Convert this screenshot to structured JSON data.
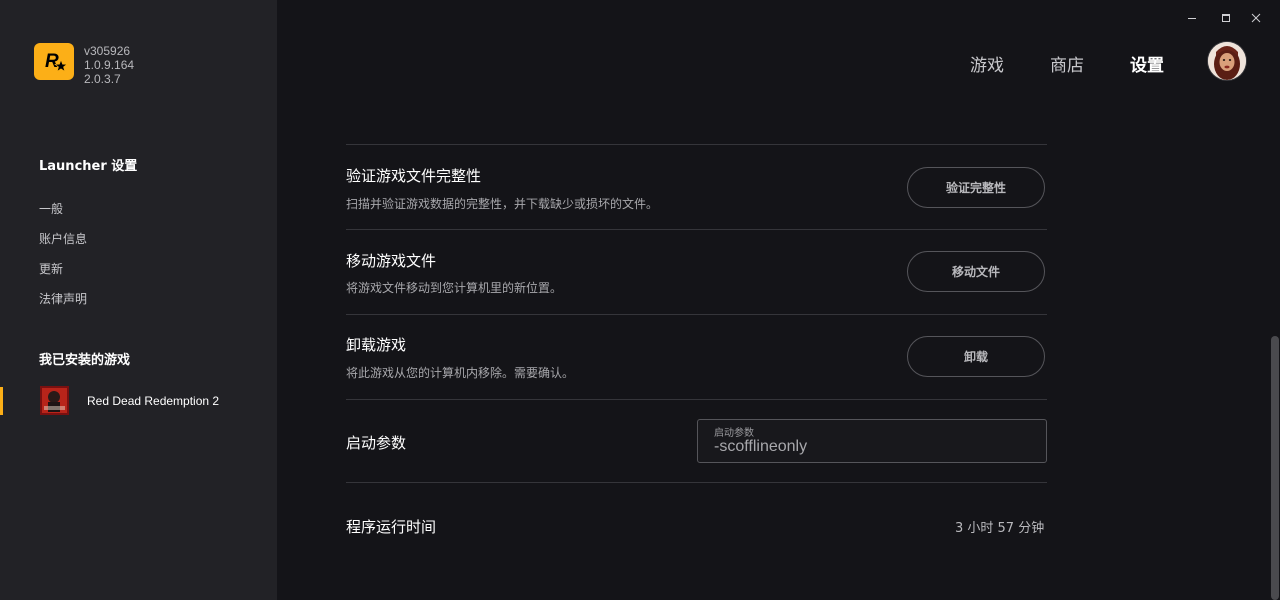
{
  "app": {
    "versions": [
      "v305926",
      "1.0.9.164",
      "2.0.3.7"
    ]
  },
  "sidebar": {
    "settings_title": "Launcher 设置",
    "items": [
      {
        "label": "一般"
      },
      {
        "label": "账户信息"
      },
      {
        "label": "更新"
      },
      {
        "label": "法律声明"
      }
    ],
    "installed_title": "我已安装的游戏",
    "games": [
      {
        "name": "Red Dead Redemption 2",
        "selected": true
      }
    ]
  },
  "topnav": {
    "tabs": [
      {
        "label": "游戏",
        "active": false
      },
      {
        "label": "商店",
        "active": false
      },
      {
        "label": "设置",
        "active": true
      }
    ]
  },
  "settings": {
    "verify": {
      "title": "验证游戏文件完整性",
      "desc": "扫描并验证游戏数据的完整性，并下载缺少或损坏的文件。",
      "button": "验证完整性"
    },
    "move": {
      "title": "移动游戏文件",
      "desc": "将游戏文件移动到您计算机里的新位置。",
      "button": "移动文件"
    },
    "uninstall": {
      "title": "卸载游戏",
      "desc": "将此游戏从您的计算机内移除。需要确认。",
      "button": "卸载"
    },
    "launch_params": {
      "title": "启动参数",
      "field_label": "启动参数",
      "value": "-scofflineonly"
    },
    "runtime": {
      "title": "程序运行时间",
      "value": "3 小时 57 分钟"
    }
  },
  "colors": {
    "accent": "#fcaf17",
    "background": "#141418",
    "sidebar": "#222226"
  },
  "icons": [
    "rockstar-logo",
    "minimize-icon",
    "maximize-icon",
    "close-icon"
  ]
}
